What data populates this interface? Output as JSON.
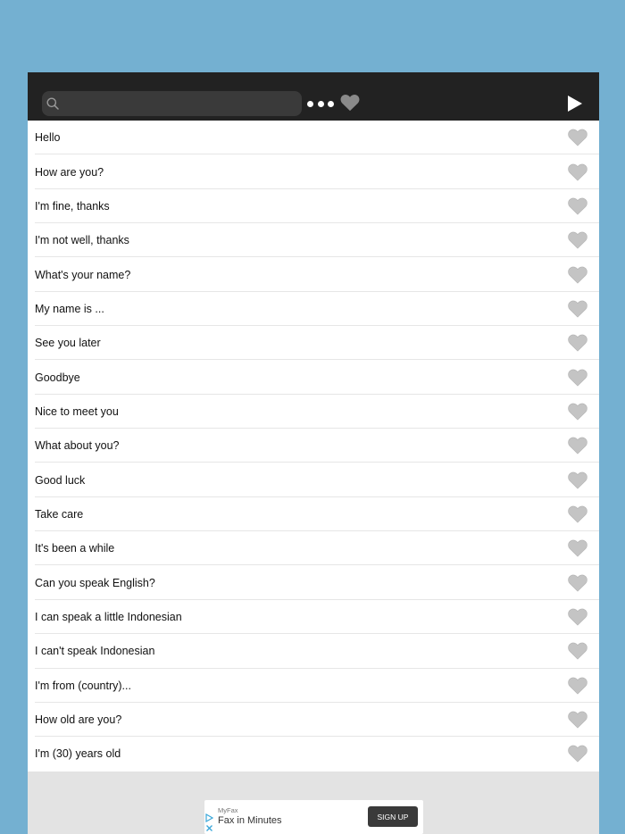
{
  "toolbar": {
    "search_placeholder": "",
    "search_icon": "search-icon",
    "more_icon": "more-dots-icon",
    "favorites_icon": "heart-icon",
    "play_icon": "play-icon"
  },
  "phrases": [
    {
      "text": "Hello",
      "favorited": false
    },
    {
      "text": "How are you?",
      "favorited": false
    },
    {
      "text": "I'm fine, thanks",
      "favorited": false
    },
    {
      "text": "I'm not well, thanks",
      "favorited": false
    },
    {
      "text": "What's your name?",
      "favorited": false
    },
    {
      "text": "My name is ...",
      "favorited": false
    },
    {
      "text": "See you later",
      "favorited": false
    },
    {
      "text": "Goodbye",
      "favorited": false
    },
    {
      "text": "Nice to meet you",
      "favorited": false
    },
    {
      "text": "What about you?",
      "favorited": false
    },
    {
      "text": "Good luck",
      "favorited": false
    },
    {
      "text": "Take care",
      "favorited": false
    },
    {
      "text": "It's been a while",
      "favorited": false
    },
    {
      "text": "Can you speak English?",
      "favorited": false
    },
    {
      "text": "I can speak a little Indonesian",
      "favorited": false
    },
    {
      "text": "I can't speak Indonesian",
      "favorited": false
    },
    {
      "text": "I'm from (country)...",
      "favorited": false
    },
    {
      "text": "How old are you?",
      "favorited": false
    },
    {
      "text": "I'm (30) years old",
      "favorited": false
    }
  ],
  "ad": {
    "brand": "MyFax",
    "headline": "Fax in Minutes",
    "cta": "SIGN UP"
  },
  "colors": {
    "page_background": "#74b0d1",
    "toolbar_background": "#222222",
    "heart_inactive": "#c4c4c4",
    "ad_area_background": "#e3e3e3"
  }
}
